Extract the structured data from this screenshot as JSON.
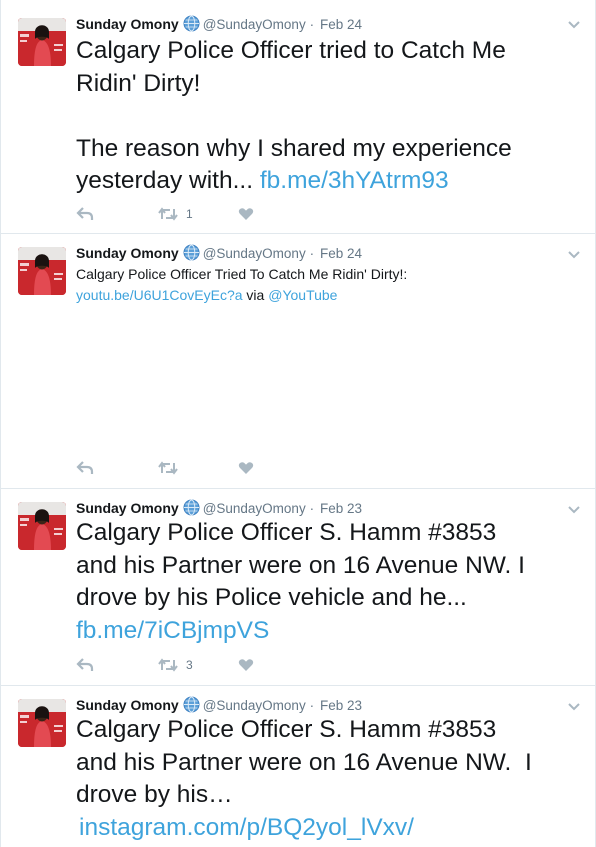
{
  "tweets": [
    {
      "name": "Sunday Omony",
      "handle": "@SundayOmony",
      "dot": "·",
      "date": "Feb 24",
      "lines": [
        "Calgary Police Officer tried to Catch Me",
        "Ridin' Dirty!",
        "",
        "The reason why I shared my experience"
      ],
      "last_prefix": "yesterday with... ",
      "link": "fb.me/3hYAtrm93",
      "retweet_count": "1",
      "like_count": ""
    },
    {
      "name": "Sunday Omony",
      "handle": "@SundayOmony",
      "dot": "·",
      "date": "Feb 24",
      "line1": "Calgary Police Officer Tried To Catch Me Ridin' Dirty!:",
      "link": "youtu.be/U6U1CovEyEc?a",
      "via": " via ",
      "mention": "@YouTube",
      "retweet_count": "",
      "like_count": ""
    },
    {
      "name": "Sunday Omony",
      "handle": "@SundayOmony",
      "dot": "·",
      "date": "Feb 23",
      "lines": [
        "Calgary Police Officer S. Hamm #3853",
        "and his Partner were on 16 Avenue NW. I",
        "drove by his Police vehicle and he..."
      ],
      "link": "fb.me/7iCBjmpVS",
      "retweet_count": "3",
      "like_count": ""
    },
    {
      "name": "Sunday Omony",
      "handle": "@SundayOmony",
      "dot": "·",
      "date": "Feb 23",
      "lines": [
        "Calgary Police Officer S. Hamm #3853",
        "and his Partner were on 16 Avenue NW.  I",
        "drove by his…"
      ],
      "link": "instagram.com/p/BQ2yol_lVxv/"
    }
  ],
  "icons": {
    "reply": "reply-icon",
    "retweet": "retweet-icon",
    "like": "heart-icon",
    "caret": "chevron-down-icon",
    "globe": "globe-icon"
  },
  "colors": {
    "link": "#3ea3dc",
    "muted": "#657786",
    "icon": "#aab8c2",
    "avatar": "#c9282d"
  }
}
